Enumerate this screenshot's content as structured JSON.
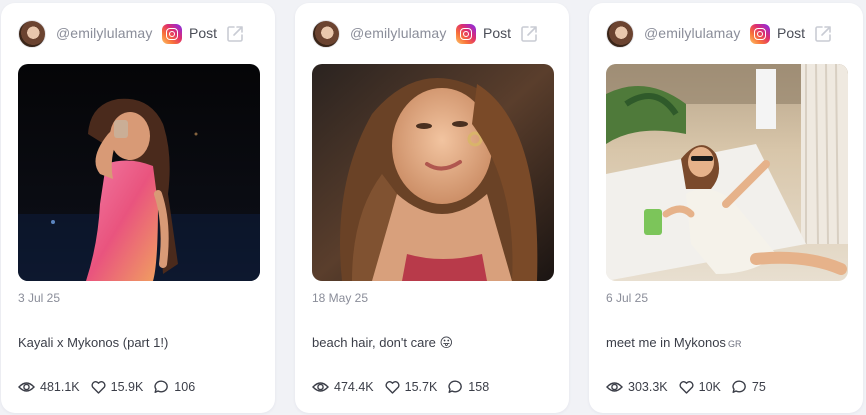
{
  "cards": [
    {
      "handle": "@emilylulamay",
      "platform_icon": "instagram-icon",
      "post_label": "Post",
      "date": "3 Jul 25",
      "caption": "Kayali x Mykonos (part 1!)",
      "caption_tag": "",
      "views": "481.1K",
      "likes": "15.9K",
      "comments": "106"
    },
    {
      "handle": "@emilylulamay",
      "platform_icon": "instagram-icon",
      "post_label": "Post",
      "date": "18 May 25",
      "caption": "beach hair, don't care 😛",
      "caption_tag": "",
      "views": "474.4K",
      "likes": "15.7K",
      "comments": "158"
    },
    {
      "handle": "@emilylulamay",
      "platform_icon": "instagram-icon",
      "post_label": "Post",
      "date": "6 Jul 25",
      "caption": "meet me in Mykonos",
      "caption_tag": "GR",
      "views": "303.3K",
      "likes": "10K",
      "comments": "75"
    }
  ],
  "colors": {
    "page_background": "#f1f2f6",
    "card_background": "#ffffff",
    "muted_text": "#8a8d99",
    "body_text": "#3b3e48"
  }
}
